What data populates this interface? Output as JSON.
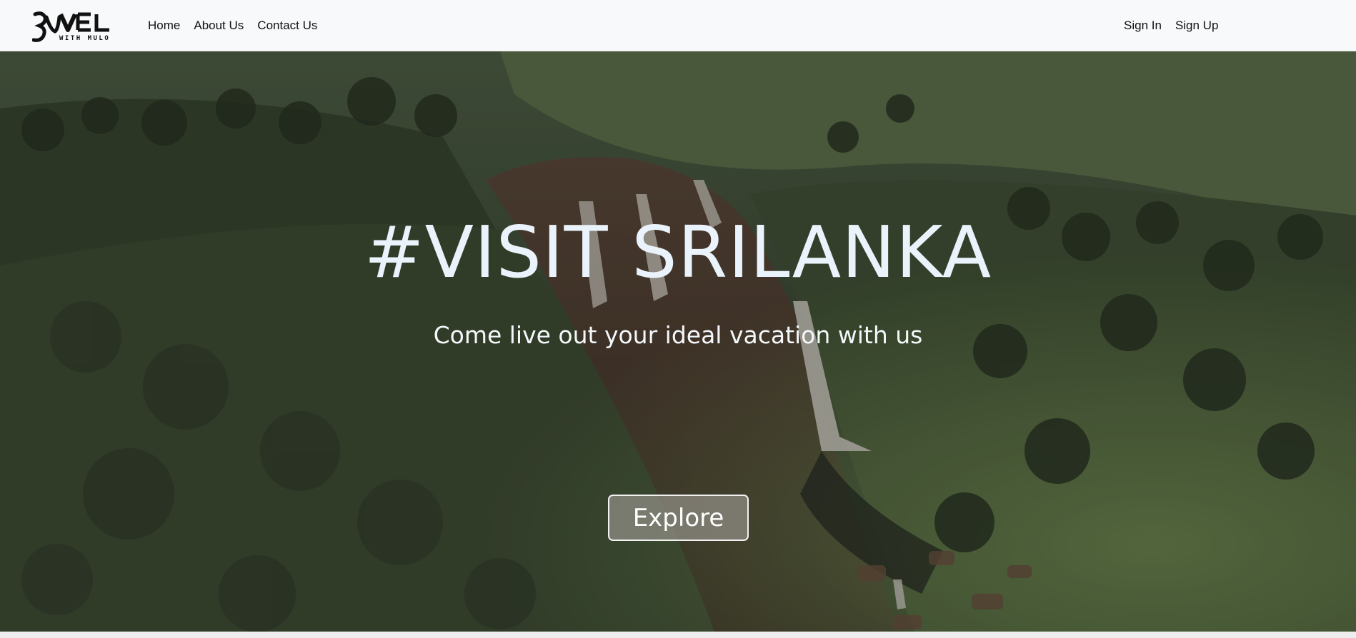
{
  "brand": {
    "logo_text": "TRAVEL WITH MULO",
    "logo_icon": "logo-mark"
  },
  "nav": {
    "left": [
      {
        "label": "Home"
      },
      {
        "label": "About Us"
      },
      {
        "label": "Contact Us"
      }
    ],
    "right": [
      {
        "label": "Sign In"
      },
      {
        "label": "Sign Up"
      }
    ]
  },
  "hero": {
    "title": "#VISIT SRILANKA",
    "subtitle": "Come live out your ideal vacation with us",
    "button_label": "Explore",
    "background_image": "waterfall-valley-aerial"
  },
  "colors": {
    "navbar_bg": "#f8f9fa",
    "hero_title": "#eaf3fb",
    "button_border": "#f1f1f1"
  }
}
